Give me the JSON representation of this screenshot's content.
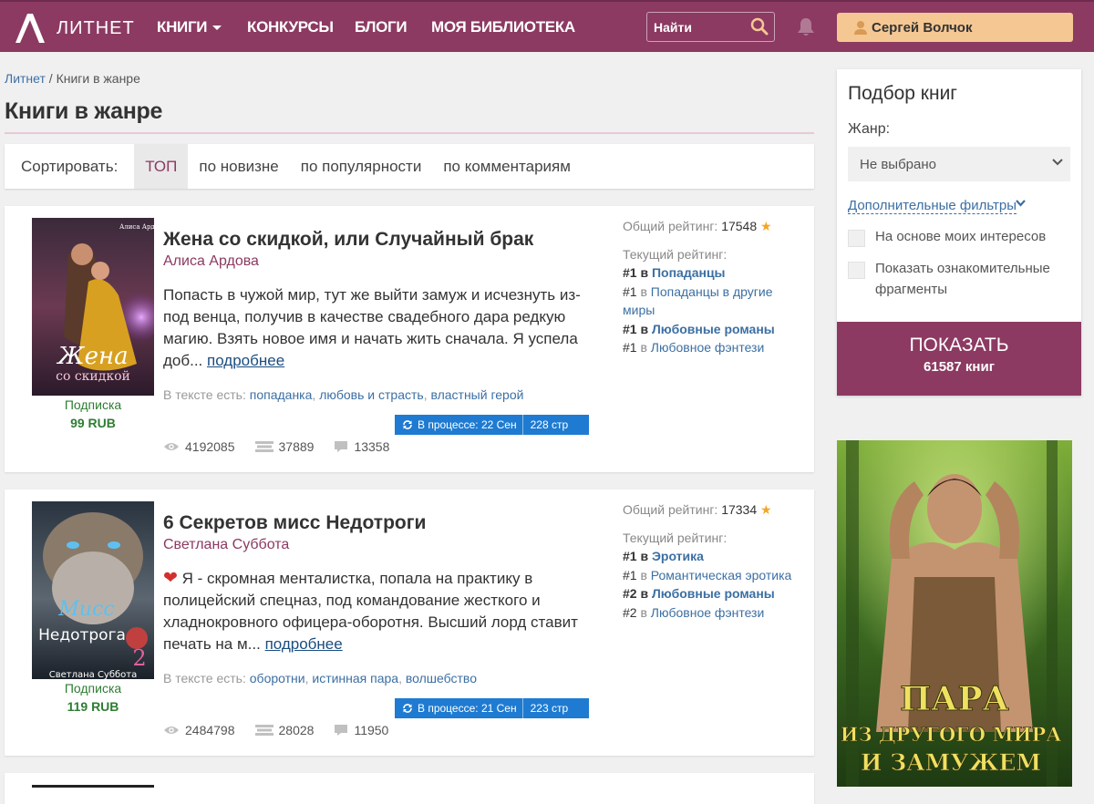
{
  "header": {
    "logo_text": "ЛИТНЕТ",
    "nav": [
      {
        "label": "Книги"
      },
      {
        "label": "Конкурсы"
      },
      {
        "label": "Блоги"
      },
      {
        "label": "Моя библиотека"
      }
    ],
    "search_placeholder": "Найти",
    "user_name": "Сергей Волчок",
    "colors": {
      "bar": "#8c3a62",
      "user_button": "#f5c793"
    }
  },
  "breadcrumb": {
    "home": "Литнет",
    "separator": "/",
    "current": "Книги в жанре"
  },
  "page_title": "Книги в жанре",
  "sort": {
    "label": "Сортировать:",
    "options": [
      "ТОП",
      "по новизне",
      "по популярности",
      "по комментариям"
    ],
    "active": "ТОП"
  },
  "books": [
    {
      "title": "Жена со скидкой, или Случайный брак",
      "author": "Алиса Ардова",
      "cover": {
        "author_text": "Алиса Ардова",
        "title_line1": "Жена",
        "title_line2": "со скидкой"
      },
      "access": "Подписка",
      "price": "99 RUB",
      "annotation_lead": "",
      "annotation": "Попасть в чужой мир, тут же выйти замуж и исчезнуть из-под венца, получив в качестве свадебного дара редкую магию. Взять новое имя и начать жить сначала. Я успела доб...",
      "more": "подробнее",
      "tags_label": "В тексте есть:",
      "tags": [
        "попаданка",
        "любовь и страсть",
        "властный герой"
      ],
      "status": "В процессе: 22 Сен",
      "pages": "228 стр",
      "views": "4192085",
      "library": "37889",
      "comments": "13358",
      "overall_label": "Общий рейтинг:",
      "overall": "17548",
      "current_label": "Текущий рейтинг:",
      "ranks": [
        {
          "rank": "#1",
          "in": "в",
          "genre": "Попаданцы",
          "bold": true
        },
        {
          "rank": "#1",
          "in": "в",
          "genre": "Попаданцы в другие миры",
          "bold": false
        },
        {
          "rank": "#1",
          "in": "в",
          "genre": "Любовные романы",
          "bold": true
        },
        {
          "rank": "#1",
          "in": "в",
          "genre": "Любовное фэнтези",
          "bold": false
        }
      ]
    },
    {
      "title": "6 Секретов мисс Недотроги",
      "author": "Светлана Суббота",
      "cover": {
        "author_text": "Светлана Суббота",
        "title_line1": "Мисс",
        "title_line2": "Недотрога",
        "num": "2"
      },
      "access": "Подписка",
      "price": "119 RUB",
      "annotation_lead": "❤",
      "annotation": " Я - скромная менталистка, попала на практику в полицейский спецназ, под командование жесткого и хладнокровного офицера-оборотня. Высший лорд ставит печать на м...",
      "more": "подробнее",
      "tags_label": "В тексте есть:",
      "tags": [
        "оборотни",
        "истинная пара",
        "волшебство"
      ],
      "status": "В процессе: 21 Сен",
      "pages": "223 стр",
      "views": "2484798",
      "library": "28028",
      "comments": "11950",
      "overall_label": "Общий рейтинг:",
      "overall": "17334",
      "current_label": "Текущий рейтинг:",
      "ranks": [
        {
          "rank": "#1",
          "in": "в",
          "genre": "Эротика",
          "bold": true
        },
        {
          "rank": "#1",
          "in": "в",
          "genre": "Романтическая эротика",
          "bold": false
        },
        {
          "rank": "#2",
          "in": "в",
          "genre": "Любовные романы",
          "bold": true
        },
        {
          "rank": "#2",
          "in": "в",
          "genre": "Любовное фэнтези",
          "bold": false
        }
      ]
    }
  ],
  "filter": {
    "title": "Подбор книг",
    "genre_label": "Жанр:",
    "genre_value": "Не выбрано",
    "more_filters": "Дополнительные фильтры",
    "checkbox_interests": "На основе моих интересов",
    "checkbox_fragments": "Показать ознакомительные фрагменты",
    "show_button": "ПОКАЗАТЬ",
    "show_count": "61587 книг"
  },
  "ad": {
    "line1": "ПАРА",
    "line2": "ИЗ ДРУГОГО МИРА",
    "line3": "И ЗАМУЖЕМ"
  }
}
